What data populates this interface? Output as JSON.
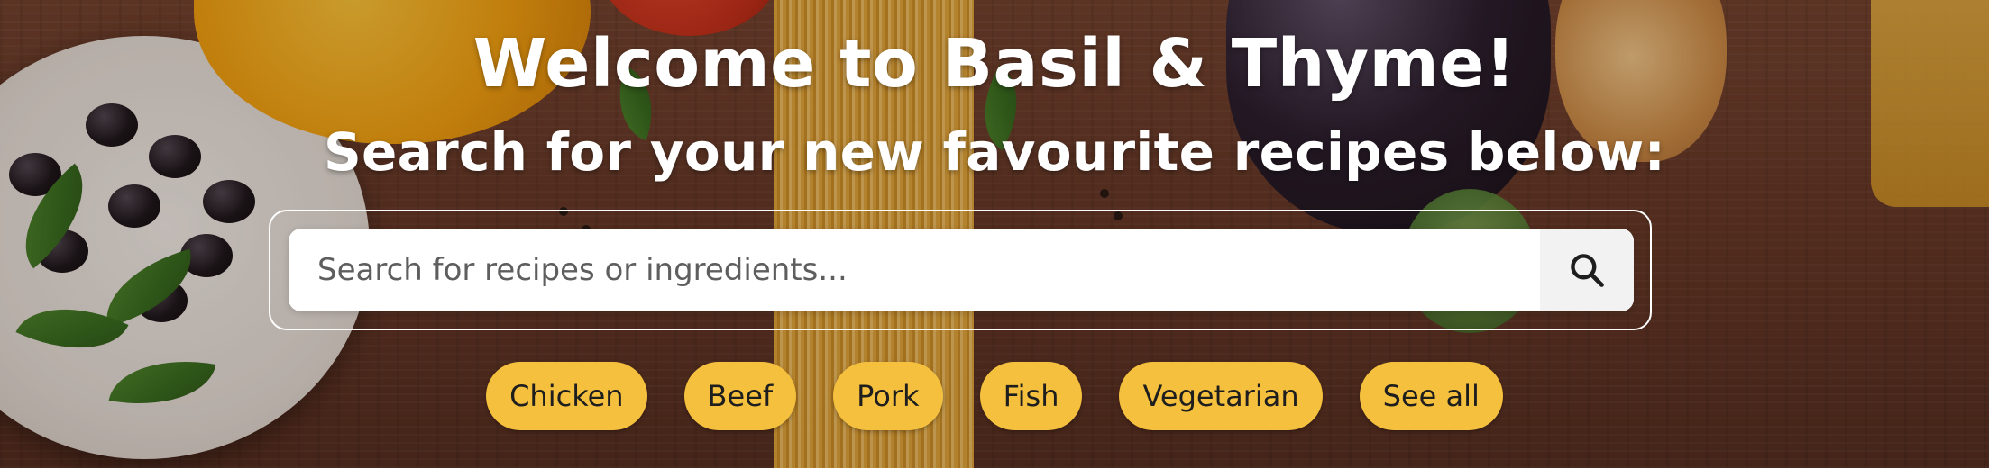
{
  "hero": {
    "title": "Welcome to Basil & Thyme!",
    "subtitle": "Search for your new favourite recipes below:"
  },
  "search": {
    "placeholder": "Search for recipes or ingredients...",
    "value": "",
    "button_icon": "search-icon"
  },
  "categories": {
    "items": [
      {
        "label": "Chicken"
      },
      {
        "label": "Beef"
      },
      {
        "label": "Pork"
      },
      {
        "label": "Fish"
      },
      {
        "label": "Vegetarian"
      },
      {
        "label": "See all"
      }
    ]
  },
  "colors": {
    "chip_background": "#f4c03e",
    "title_text": "#ffffff",
    "background_wood": "#5d3324"
  }
}
